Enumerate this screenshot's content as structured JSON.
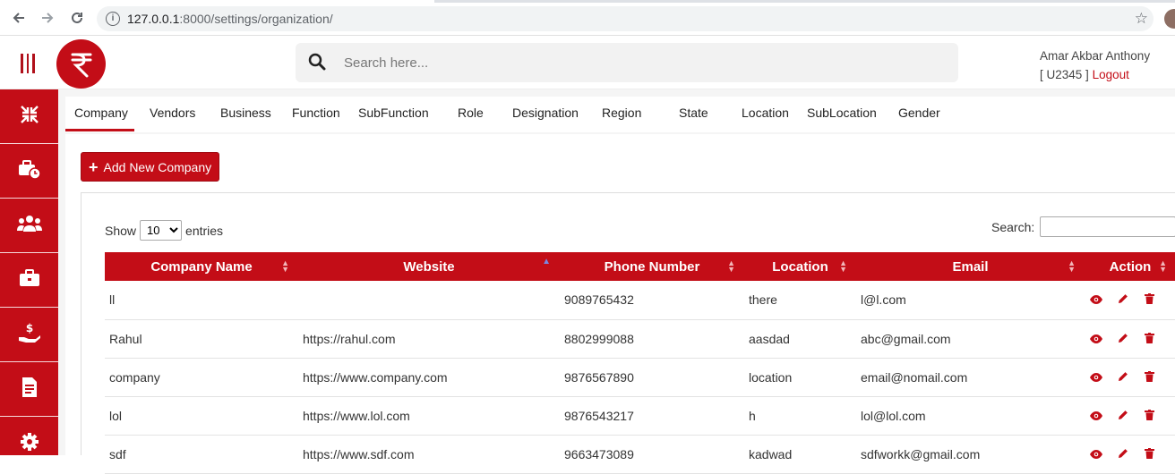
{
  "browser": {
    "url_host": "127.0.0.1",
    "url_rest": ":8000/settings/organization/"
  },
  "header": {
    "search_placeholder": "Search here...",
    "user_name": "Amar Akbar Anthony",
    "user_id_prefix": "[ U2345 ]",
    "logout_label": "Logout",
    "logo_glyph": "₹"
  },
  "sidebar": {
    "items": [
      {
        "icon": "compress-arrows-icon"
      },
      {
        "icon": "briefcase-clock-icon"
      },
      {
        "icon": "users-icon"
      },
      {
        "icon": "briefcase-icon"
      },
      {
        "icon": "hand-dollar-icon"
      },
      {
        "icon": "document-icon"
      },
      {
        "icon": "gear-icon"
      }
    ]
  },
  "tabs": [
    "Company",
    "Vendors",
    "Business",
    "Function",
    "SubFunction",
    "Role",
    "Designation",
    "Region",
    "State",
    "Location",
    "SubLocation",
    "Gender"
  ],
  "active_tab": "Company",
  "actions": {
    "add_label": "Add New Company"
  },
  "datatable": {
    "show_label": "Show",
    "entries_value": "10",
    "entries_label": "entries",
    "search_label": "Search:",
    "columns": [
      "Company Name",
      "Website",
      "Phone Number",
      "Location",
      "Email",
      "Action"
    ],
    "rows": [
      {
        "name": "ll",
        "website": "",
        "phone": "9089765432",
        "location": "there",
        "email": "l@l.com"
      },
      {
        "name": "Rahul",
        "website": "https://rahul.com",
        "phone": "8802999088",
        "location": "aasdad",
        "email": "abc@gmail.com"
      },
      {
        "name": "company",
        "website": "https://www.company.com",
        "phone": "9876567890",
        "location": "location",
        "email": "email@nomail.com"
      },
      {
        "name": "lol",
        "website": "https://www.lol.com",
        "phone": "9876543217",
        "location": "h",
        "email": "lol@lol.com"
      },
      {
        "name": "sdf",
        "website": "https://www.sdf.com",
        "phone": "9663473089",
        "location": "kadwad",
        "email": "sdfworkk@gmail.com"
      }
    ]
  },
  "colors": {
    "brand": "#c30d17",
    "page_bg": "#f5f5f5"
  }
}
